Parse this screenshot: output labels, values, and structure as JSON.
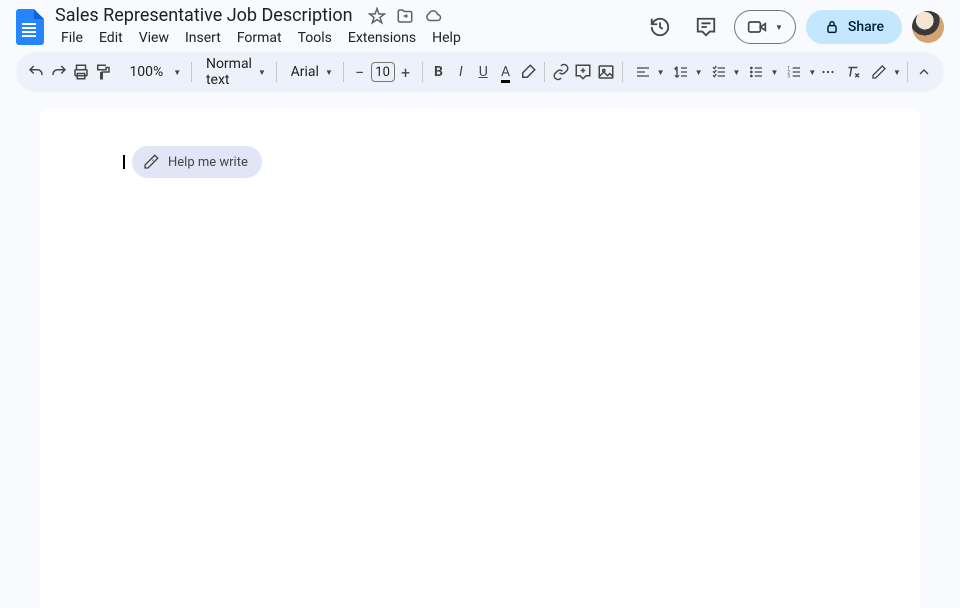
{
  "doc": {
    "title": "Sales Representative Job Description"
  },
  "menus": [
    "File",
    "Edit",
    "View",
    "Insert",
    "Format",
    "Tools",
    "Extensions",
    "Help"
  ],
  "toolbar": {
    "zoom": "100%",
    "style": "Normal text",
    "font": "Arial",
    "font_size": "10"
  },
  "share": {
    "label": "Share"
  },
  "help_chip": {
    "label": "Help me write"
  }
}
